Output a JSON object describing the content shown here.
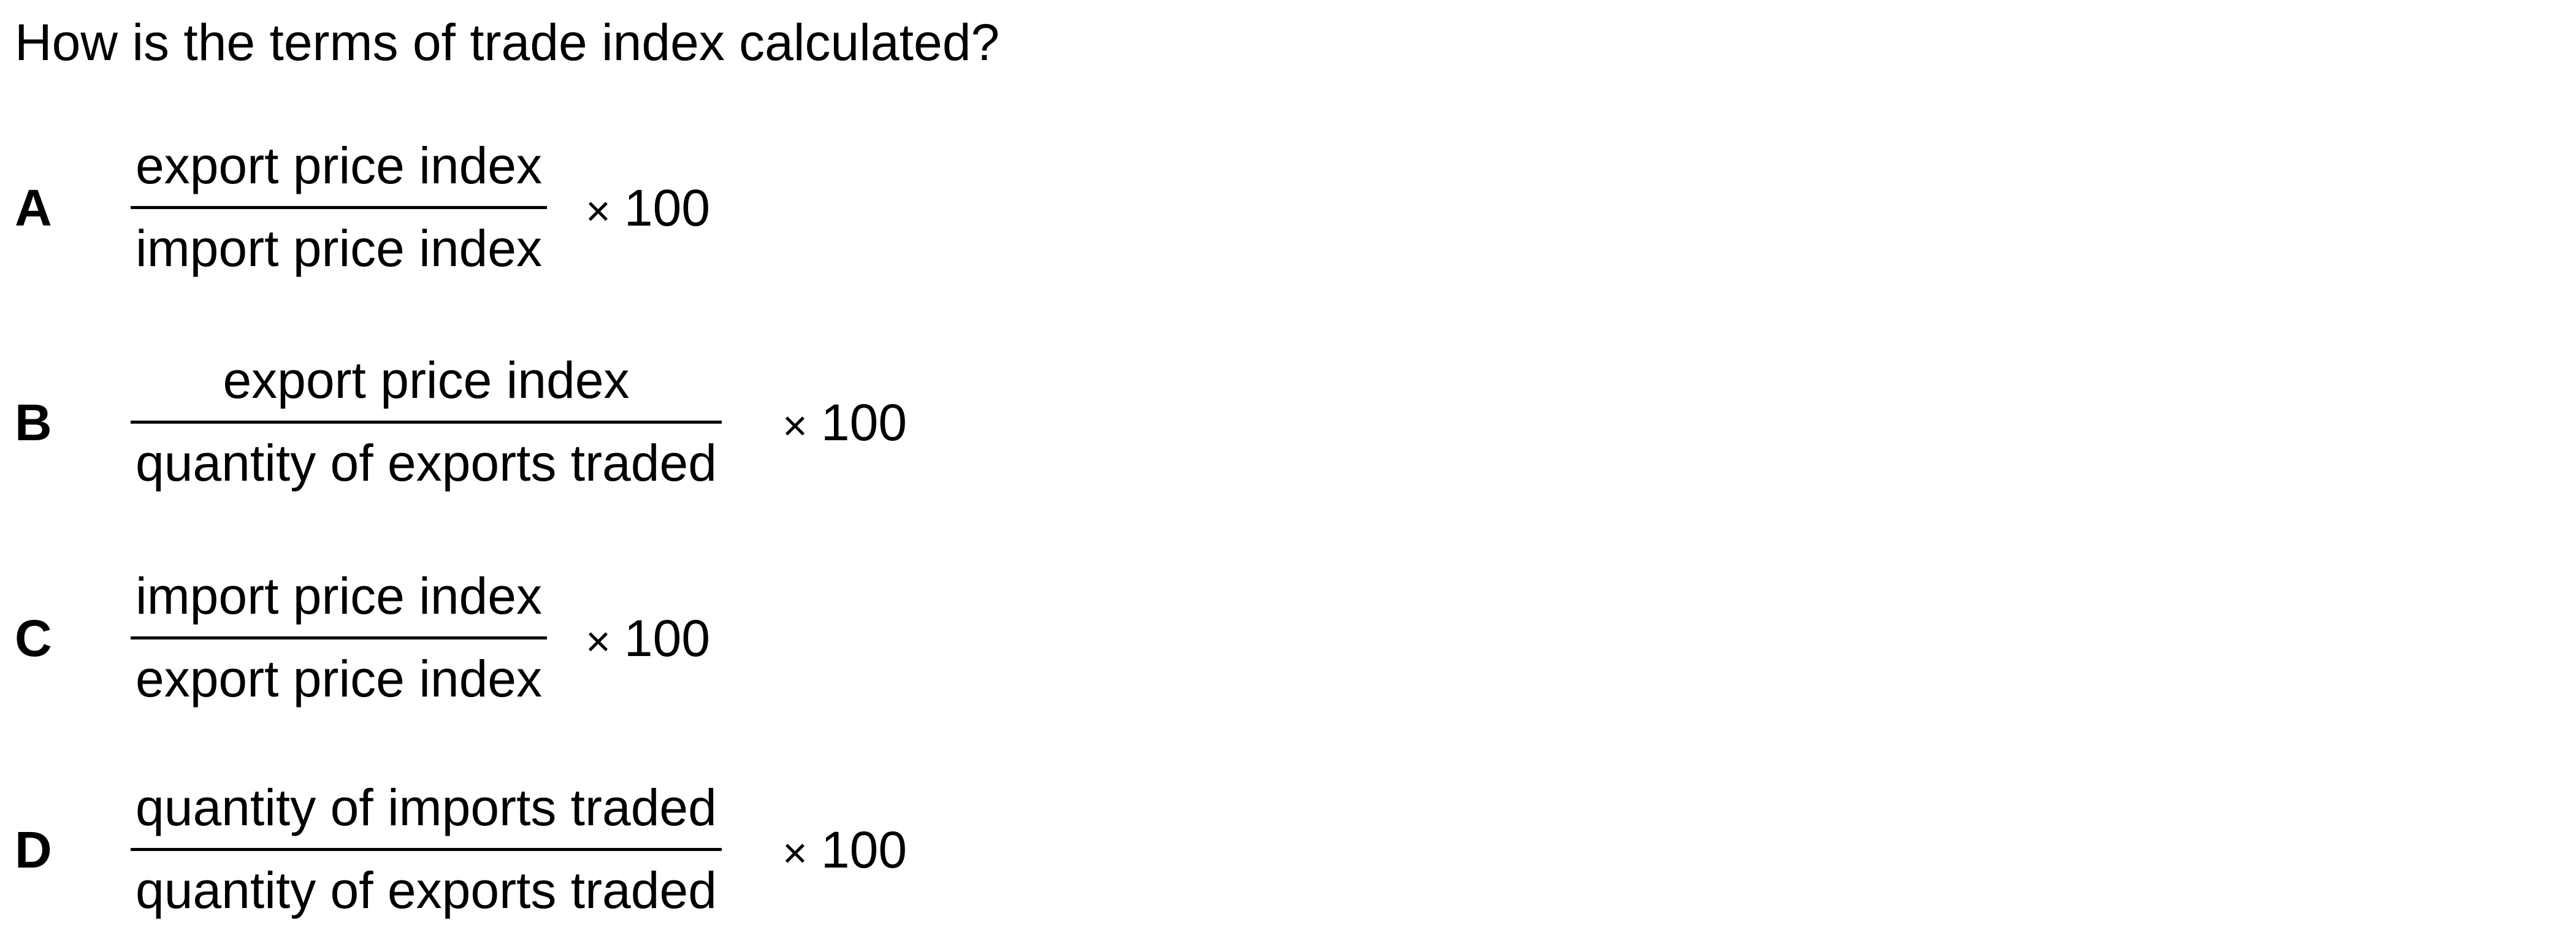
{
  "question": "How is the terms of trade index calculated?",
  "options": [
    {
      "letter": "A",
      "numerator": "export price index",
      "denominator": "import price index",
      "times": "×",
      "multiplier": "100"
    },
    {
      "letter": "B",
      "numerator": "export price index",
      "denominator": "quantity of exports traded",
      "times": "×",
      "multiplier": "100"
    },
    {
      "letter": "C",
      "numerator": "import price index",
      "denominator": "export price index",
      "times": "×",
      "multiplier": "100"
    },
    {
      "letter": "D",
      "numerator": "quantity of imports traded",
      "denominator": "quantity of exports traded",
      "times": "×",
      "multiplier": "100"
    }
  ]
}
